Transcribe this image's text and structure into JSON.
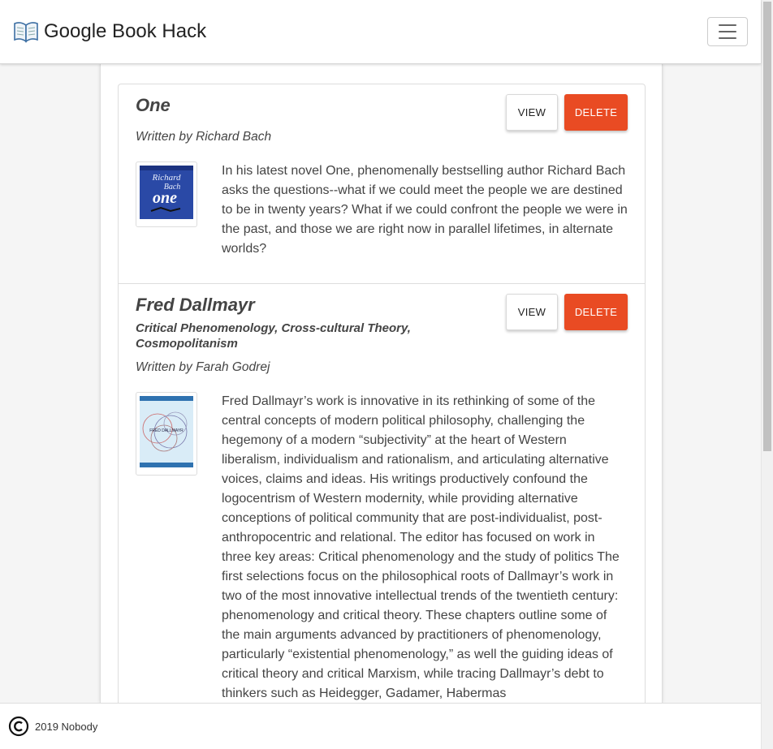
{
  "app": {
    "title": "Google Book Hack"
  },
  "books": [
    {
      "title": "One",
      "subtitle": "",
      "author_line": "Written by Richard Bach",
      "view_label": "VIEW",
      "delete_label": "DELETE",
      "cover_text": [
        "Richard",
        "Bach",
        "one"
      ],
      "description": "In his latest novel One, phenomenally bestselling author Richard Bach asks the questions--what if we could meet the people we are destined to be in twenty years? What if we could confront the people we were in the past, and those we are right now in parallel lifetimes, in alternate worlds?"
    },
    {
      "title": "Fred Dallmayr",
      "subtitle": "Critical Phenomenology, Cross-cultural Theory, Cosmopolitanism",
      "author_line": "Written by Farah Godrej",
      "view_label": "VIEW",
      "delete_label": "DELETE",
      "cover_text": [
        "FRED DALLMAYR"
      ],
      "description": "Fred Dallmayr’s work is innovative in its rethinking of some of the central concepts of modern political philosophy, challenging the hegemony of a modern “subjectivity” at the heart of Western liberalism, individualism and rationalism, and articulating alternative voices, claims and ideas. His writings productively confound the logocentrism of Western modernity, while providing alternative conceptions of political community that are post-individualist, post-anthropocentric and relational. The editor has focused on work in three key areas: Critical phenomenology and the study of politics The first selections focus on the philosophical roots of Dallmayr’s work in two of the most innovative intellectual trends of the twentieth century: phenomenology and critical theory. These chapters outline some of the main arguments advanced by practitioners of phenomenology, particularly “existential phenomenology,” as well the guiding ideas of critical theory and critical Marxism, while tracing Dallmayr’s debt to thinkers such as Heidegger, Gadamer, Habermas"
    }
  ],
  "footer": {
    "text": "2019 Nobody"
  },
  "colors": {
    "delete": "#e94b23",
    "cover_one": "#2a49a6",
    "cover_two": "#d9ecf7"
  },
  "icons": {
    "brand": "open-book-icon",
    "menu": "hamburger-menu-icon",
    "footer": "copyright-icon"
  }
}
